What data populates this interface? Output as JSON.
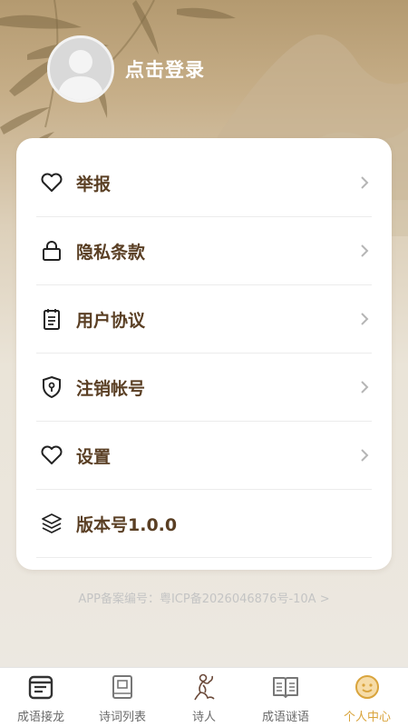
{
  "profile": {
    "login_text": "点击登录"
  },
  "menu": {
    "items": [
      {
        "label": "举报",
        "icon": "heart-icon",
        "arrow": true
      },
      {
        "label": "隐私条款",
        "icon": "lock-icon",
        "arrow": true
      },
      {
        "label": "用户协议",
        "icon": "document-icon",
        "arrow": true
      },
      {
        "label": "注销帐号",
        "icon": "shield-icon",
        "arrow": true
      },
      {
        "label": "设置",
        "icon": "heart-icon",
        "arrow": true
      },
      {
        "label": "版本号1.0.0",
        "icon": "layers-icon",
        "arrow": false
      }
    ]
  },
  "icp": {
    "text": "APP备案编号：粤ICP备2026046876号-10A >"
  },
  "tabbar": {
    "tabs": [
      {
        "label": "成语接龙",
        "icon": "calendar-book-icon",
        "active": false
      },
      {
        "label": "诗词列表",
        "icon": "book-icon",
        "active": false
      },
      {
        "label": "诗人",
        "icon": "poet-figure-icon",
        "active": false
      },
      {
        "label": "成语谜语",
        "icon": "open-book-icon",
        "active": false
      },
      {
        "label": "个人中心",
        "icon": "smiley-icon",
        "active": true
      }
    ]
  },
  "colors": {
    "header_brown": "#b49a70",
    "label_brown": "#5a3f24",
    "active_tab": "#d9a43c",
    "inactive_tab": "#6a6a6a"
  }
}
